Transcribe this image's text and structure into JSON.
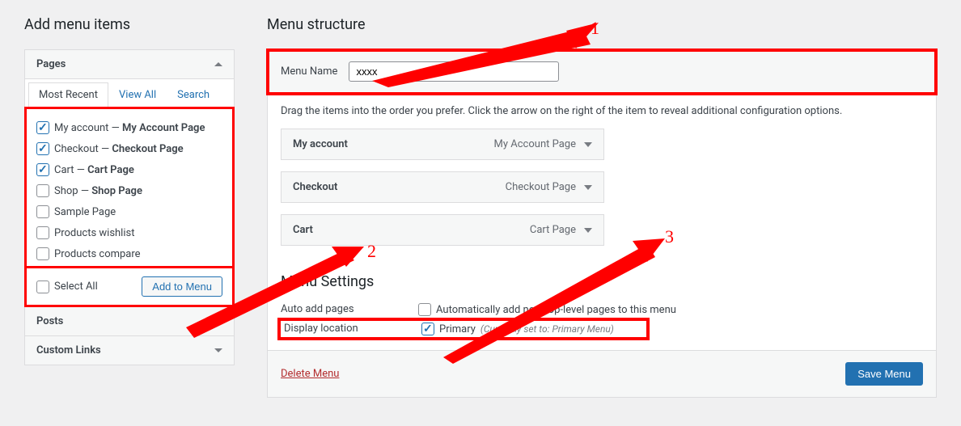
{
  "left": {
    "heading": "Add menu items",
    "pages_label": "Pages",
    "tabs": {
      "recent": "Most Recent",
      "viewall": "View All",
      "search": "Search"
    },
    "items": [
      {
        "title": "My account",
        "type": "My Account Page",
        "checked": true
      },
      {
        "title": "Checkout",
        "type": "Checkout Page",
        "checked": true
      },
      {
        "title": "Cart",
        "type": "Cart Page",
        "checked": true
      },
      {
        "title": "Shop",
        "type": "Shop Page",
        "checked": false
      },
      {
        "title": "Sample Page",
        "type": "",
        "checked": false
      },
      {
        "title": "Products wishlist",
        "type": "",
        "checked": false
      },
      {
        "title": "Products compare",
        "type": "",
        "checked": false
      }
    ],
    "select_all": "Select All",
    "add_to_menu": "Add to Menu",
    "posts_label": "Posts",
    "custom_links_label": "Custom Links"
  },
  "right": {
    "heading": "Menu structure",
    "menu_name_label": "Menu Name",
    "menu_name_value": "xxxx",
    "instructions": "Drag the items into the order you prefer. Click the arrow on the right of the item to reveal additional configuration options.",
    "menu_items": [
      {
        "title": "My account",
        "type": "My Account Page"
      },
      {
        "title": "Checkout",
        "type": "Checkout Page"
      },
      {
        "title": "Cart",
        "type": "Cart Page"
      }
    ],
    "settings_heading": "Menu Settings",
    "auto_add_label": "Auto add pages",
    "auto_add_check": "Automatically add new top-level pages to this menu",
    "display_loc_label": "Display location",
    "primary_label": "Primary",
    "primary_hint": "(Currently set to: Primary Menu)",
    "delete_menu": "Delete Menu",
    "save_menu": "Save Menu"
  },
  "annos": {
    "n1": "1",
    "n2": "2",
    "n3": "3"
  }
}
